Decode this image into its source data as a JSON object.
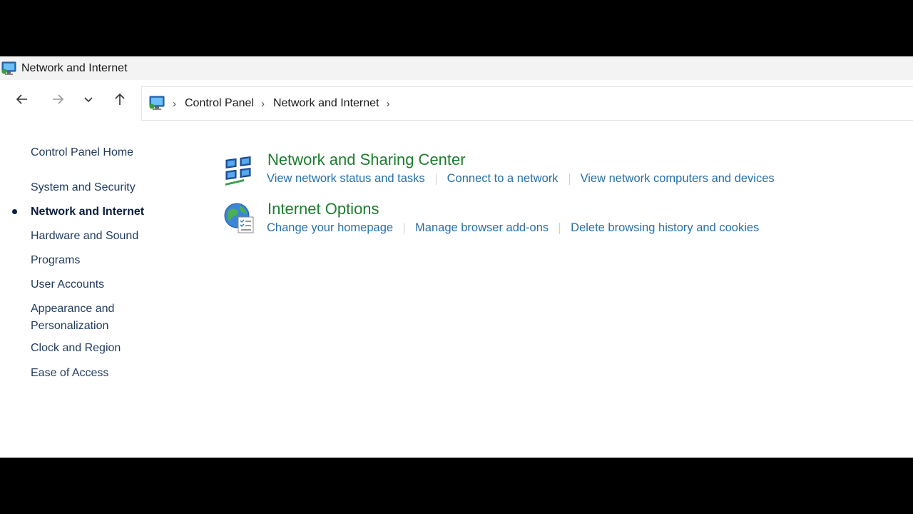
{
  "window": {
    "title": "Network and Internet"
  },
  "nav": {
    "back": "back-arrow",
    "forward": "forward-arrow",
    "recent": "chevron-down",
    "up": "up-arrow"
  },
  "address": {
    "separator": "›",
    "crumbs": [
      "Control Panel",
      "Network and Internet"
    ]
  },
  "sidebar": {
    "home": "Control Panel Home",
    "items": [
      {
        "label": "System and Security"
      },
      {
        "label": "Network and Internet",
        "active": true
      },
      {
        "label": "Hardware and Sound"
      },
      {
        "label": "Programs"
      },
      {
        "label": "User Accounts"
      },
      {
        "label_line1": "Appearance and",
        "label_line2": "Personalization"
      },
      {
        "label": "Clock and Region"
      },
      {
        "label": "Ease of Access"
      }
    ]
  },
  "categories": [
    {
      "title": "Network and Sharing Center",
      "icon": "network-sharing-center",
      "links": [
        "View network status and tasks",
        "Connect to a network",
        "View network computers and devices"
      ]
    },
    {
      "title": "Internet Options",
      "icon": "internet-options",
      "links": [
        "Change your homepage",
        "Manage browser add-ons",
        "Delete browsing history and cookies"
      ]
    }
  ],
  "colors": {
    "category_title": "#1e7d2f",
    "link": "#2a6fa8",
    "sidebar_text": "#1f3a5f",
    "titlebar_bg": "#f3f3f3"
  }
}
